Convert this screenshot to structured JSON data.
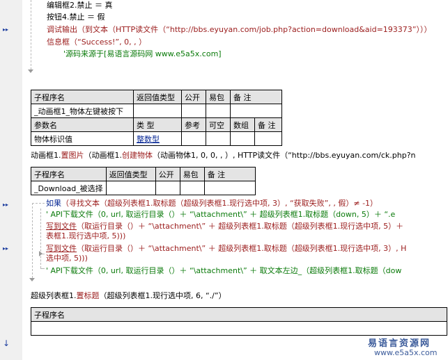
{
  "code": {
    "line1": "编辑框2.禁止 ＝ 真",
    "line2": "按钮4.禁止 ＝ 假",
    "line3_fn": "调试输出",
    "line3_arg": "（到文本（HTTP读文件（“http://bbs.eyuyan.com/job.php?action=download&aid=193373”）））",
    "line4_fn": "信息框",
    "line4_arg": "（“Success!”, 0, , ）",
    "line5": "'源码来源于[易语言源码网 www.e5a5x.com]"
  },
  "table1": {
    "headers": [
      "子程序名",
      "返回值类型",
      "公开",
      "易包",
      "备 注"
    ],
    "row": [
      "_动画框1_物体左键被按下",
      "",
      "",
      "",
      ""
    ],
    "param_headers": [
      "参数名",
      "类 型",
      "参考",
      "可空",
      "数组",
      "备 注"
    ],
    "param_row": [
      "物体标识值",
      "整数型",
      "",
      "",
      "",
      ""
    ]
  },
  "code2": {
    "line1_obj": "动画框1.",
    "line1_fn": "置图片",
    "line1_mid": "（动画框1.",
    "line1_fn2": "创建物体",
    "line1_rest": "（动画物体1, 0, 0, , ）, HTTP读文件（“http://bbs.eyuyan.com/ck.php?n"
  },
  "table2": {
    "headers": [
      "子程序名",
      "返回值类型",
      "公开",
      "易包",
      "备 注"
    ],
    "row": [
      "_Download_被选择",
      "",
      "",
      "",
      ""
    ]
  },
  "code3": {
    "if_kw": "如果",
    "if_rest": "（寻找文本（超级列表框1.取标题（超级列表框1.现行选中项, 3）, “获取失败”, , 假）≠ -1）",
    "c1": "' API下载文件（0, url, 取运行目录（）＋ “\\attachment\\” ＋ 超级列表框1.取标题（down, 5）＋ “.e",
    "w1_fn": "写到文件",
    "w1_rest": "（取运行目录（）＋ “\\attachment\\” ＋ 超级列表框1.取标题（超级列表框1.现行选中项, 5）＋",
    "w1_cont": "表框1.现行选中项, 5)))",
    "w2_fn": "写到文件",
    "w2_rest": "（取运行目录（）＋ “\\attachment\\” ＋ 超级列表框1.取标题（超级列表框1.现行选中项, 3）, H",
    "w2_cont": "选中项, 5)))",
    "c2": "' API下载文件（0, url, 取运行目录（）＋ “\\attachment\\” ＋ 取文本左边_（超级列表框1.取标题（dow"
  },
  "code4": {
    "obj": "超级列表框1.",
    "fn": "置标题",
    "rest": "（超级列表框1.现行选中项, 6, “./”）"
  },
  "table3": {
    "headers": [
      "子程序名"
    ]
  },
  "watermark": {
    "title": "易语言资源网",
    "url": "www.e5a5x.com"
  }
}
